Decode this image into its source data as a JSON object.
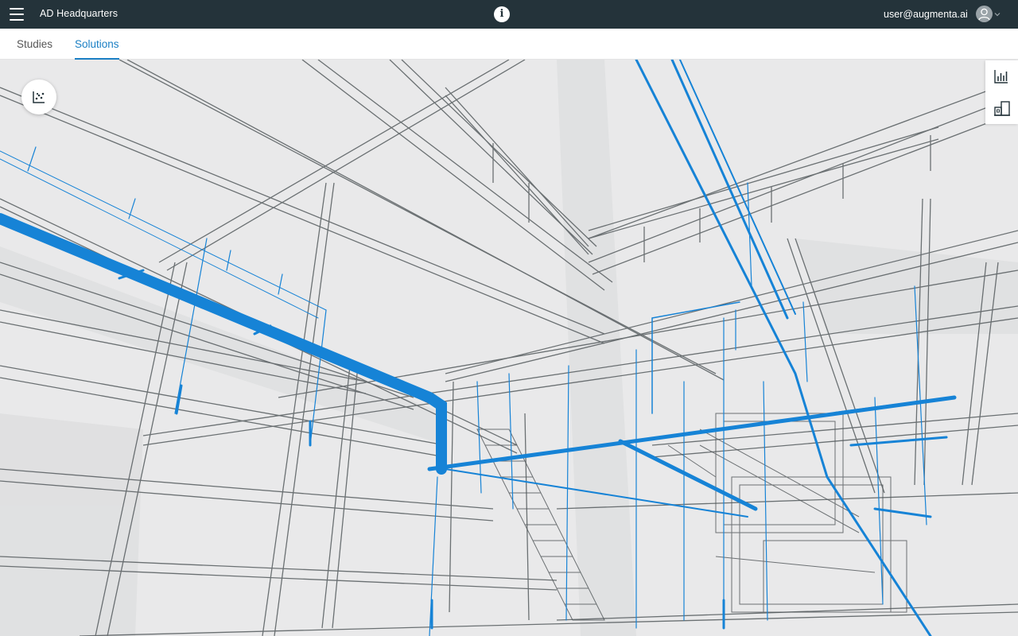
{
  "header": {
    "app_title": "AD Headquarters",
    "user_email": "user@augmenta.ai",
    "menu_icon": "hamburger-menu-icon",
    "info_icon": "info-icon",
    "avatar_icon": "user-avatar-icon",
    "caret_icon": "chevron-down-icon"
  },
  "tabs": [
    {
      "label": "Studies",
      "active": false
    },
    {
      "label": "Solutions",
      "active": true
    }
  ],
  "viewport": {
    "fab_icon": "scatter-plot-icon",
    "side_tools": [
      {
        "icon": "bar-chart-icon"
      },
      {
        "icon": "building-icon"
      }
    ]
  },
  "colors": {
    "topbar": "#24333a",
    "accent": "#1a7fc4",
    "pipe_blue": "#1683d6",
    "structure": "#5d6366"
  }
}
